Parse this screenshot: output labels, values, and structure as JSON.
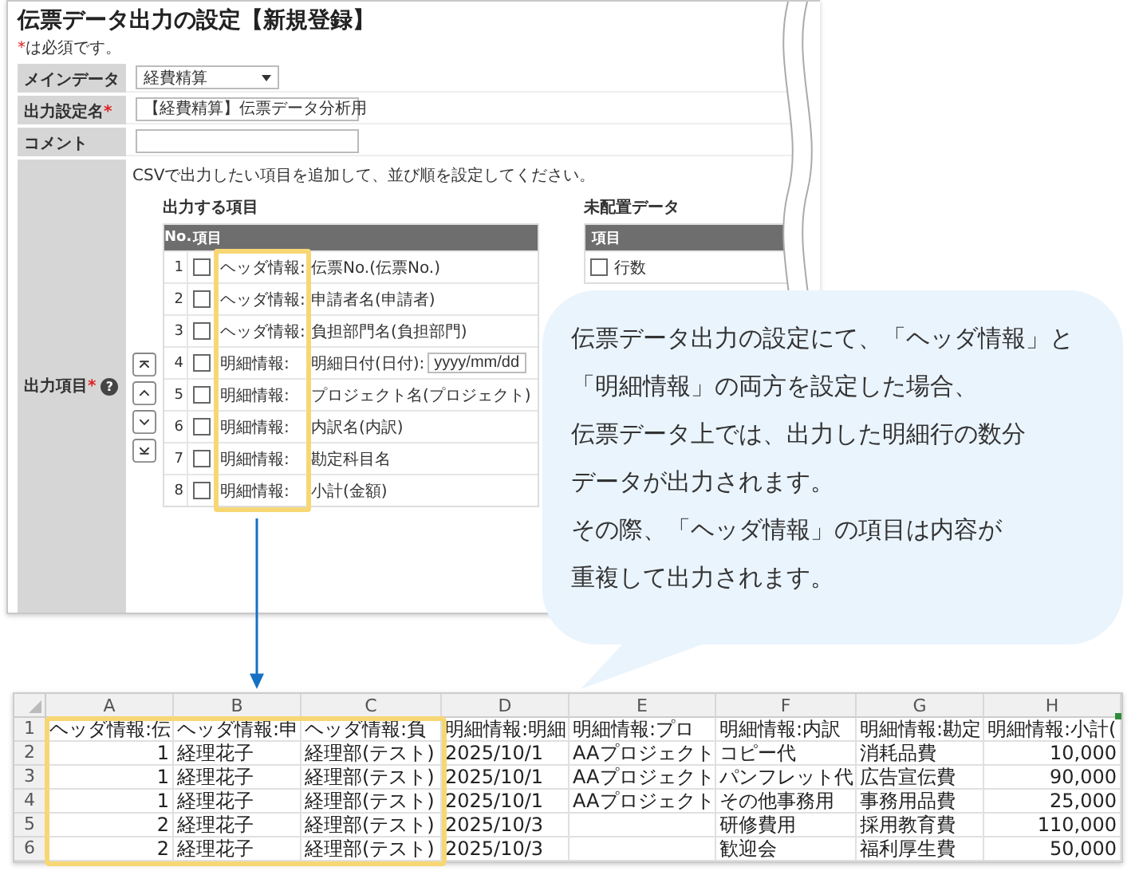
{
  "form": {
    "title": "伝票データ出力の設定【新規登録】",
    "required_mark": "*",
    "required_note": "は必須です。",
    "fields": [
      {
        "label": "メインデータ",
        "required": false,
        "kind": "select",
        "value": "経費精算"
      },
      {
        "label": "出力設定名",
        "required": true,
        "kind": "text",
        "value": "【経費精算】伝票データ分析用"
      },
      {
        "label": "コメント",
        "required": false,
        "kind": "text"
      }
    ],
    "output_items": {
      "label": "出力項目",
      "required": true,
      "help": "?",
      "instruction": "CSVで出力したい項目を追加して、並び順を設定してください。",
      "selected_heading": "出力する項目",
      "columns": [
        "No.",
        "項目"
      ],
      "rows": [
        {
          "no": "1",
          "checked": false,
          "prefix": "ヘッダ情報:",
          "name": "伝票No.(伝票No.)"
        },
        {
          "no": "2",
          "checked": false,
          "prefix": "ヘッダ情報:",
          "name": "申請者名(申請者)"
        },
        {
          "no": "3",
          "checked": false,
          "prefix": "ヘッダ情報:",
          "name": "負担部門名(負担部門)"
        },
        {
          "no": "4",
          "checked": false,
          "prefix": "明細情報:",
          "name": "明細日付(日付):",
          "date_format": "yyyy/mm/dd"
        },
        {
          "no": "5",
          "checked": false,
          "prefix": "明細情報:",
          "name": "プロジェクト名(プロジェクト)"
        },
        {
          "no": "6",
          "checked": false,
          "prefix": "明細情報:",
          "name": "内訳名(内訳)"
        },
        {
          "no": "7",
          "checked": false,
          "prefix": "明細情報:",
          "name": "勘定科目名"
        },
        {
          "no": "8",
          "checked": false,
          "prefix": "明細情報:",
          "name": "小計(金額)"
        }
      ],
      "unassigned_heading": "未配置データ",
      "unassigned_columns": [
        "項目"
      ],
      "unassigned_rows": [
        {
          "checked": false,
          "name": "行数"
        }
      ]
    }
  },
  "callout": {
    "lines": [
      "伝票データ出力の設定にて、「ヘッダ情報」と",
      "「明細情報」の両方を設定した場合、",
      "伝票データ上では、出力した明細行の数分",
      "データが出力されます。",
      "その際、「ヘッダ情報」の項目は内容が",
      "重複して出力されます。"
    ]
  },
  "spreadsheet": {
    "columns": [
      {
        "letter": "A",
        "kind": "number"
      },
      {
        "letter": "B",
        "kind": "text"
      },
      {
        "letter": "C",
        "kind": "text"
      },
      {
        "letter": "D",
        "kind": "text"
      },
      {
        "letter": "E",
        "kind": "text"
      },
      {
        "letter": "F",
        "kind": "text"
      },
      {
        "letter": "G",
        "kind": "text"
      },
      {
        "letter": "H",
        "kind": "number"
      }
    ],
    "rows": [
      {
        "num": "1",
        "kind": "header",
        "cells": [
          "ヘッダ情報:伝",
          "ヘッダ情報:申",
          "ヘッダ情報:負",
          "明細情報:明細",
          "明細情報:プロ",
          "明細情報:内訳",
          "明細情報:勘定",
          "明細情報:小計("
        ]
      },
      {
        "num": "2",
        "kind": "data",
        "cells": [
          "1",
          "経理花子",
          "経理部(テスト)",
          "2025/10/1",
          "AAプロジェクト",
          "コピー代",
          "消耗品費",
          "10,000"
        ]
      },
      {
        "num": "3",
        "kind": "data",
        "cells": [
          "1",
          "経理花子",
          "経理部(テスト)",
          "2025/10/1",
          "AAプロジェクト",
          "パンフレット代",
          "広告宣伝費",
          "90,000"
        ]
      },
      {
        "num": "4",
        "kind": "data",
        "cells": [
          "1",
          "経理花子",
          "経理部(テスト)",
          "2025/10/1",
          "AAプロジェクト",
          "その他事務用",
          "事務用品費",
          "25,000"
        ]
      },
      {
        "num": "5",
        "kind": "data",
        "cells": [
          "2",
          "経理花子",
          "経理部(テスト)",
          "2025/10/3",
          null,
          "研修費用",
          "採用教育費",
          "110,000"
        ]
      },
      {
        "num": "6",
        "kind": "data",
        "cells": [
          "2",
          "経理花子",
          "経理部(テスト)",
          "2025/10/3",
          null,
          "歓迎会",
          "福利厚生費",
          "50,000"
        ]
      }
    ]
  }
}
